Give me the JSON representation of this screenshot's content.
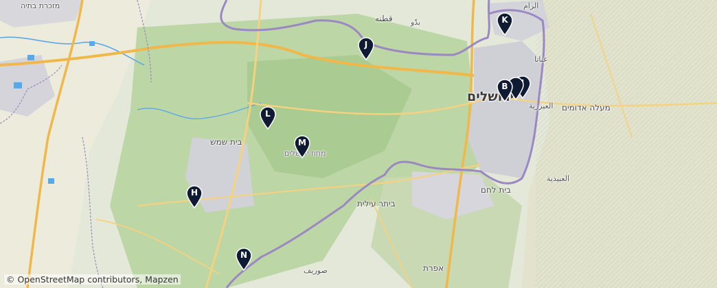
{
  "labels": {
    "top_left_town": "מזכרת בתיה",
    "qatanna": "قطنه",
    "biddu": "بدّو",
    "bir_nabala": "الرام",
    "anata": "عناتا",
    "jerusalem": "ירושלים",
    "azariya": "العيزرية",
    "maale_adumim": "מעלה אדומים",
    "beit_shemesh": "בית שמש",
    "mahoz": "מחוז ירושלים",
    "ubeidiya": "العبيدية",
    "beitar_illit": "ביתר עילית",
    "beit_lehem": "בית לחם",
    "surif": "صوريف",
    "efrat": "אפרת"
  },
  "markers": [
    {
      "id": "K",
      "label": "K"
    },
    {
      "id": "J",
      "label": "J"
    },
    {
      "id": "B",
      "label": "B"
    },
    {
      "id": "I",
      "label": "I"
    },
    {
      "id": "L",
      "label": "L"
    },
    {
      "id": "M",
      "label": "M"
    },
    {
      "id": "H",
      "label": "H"
    },
    {
      "id": "N",
      "label": "N"
    }
  ],
  "attribution": "© OpenStreetMap contributors, Mapzen",
  "colors": {
    "marker": "#0e1b33",
    "border": "#9b87c2",
    "road_major": "#f0b84a",
    "road_minor": "#f5d27f",
    "urban": "#c9c9d1",
    "forest": "#b7d3a0",
    "water": "#5aa9e6"
  }
}
